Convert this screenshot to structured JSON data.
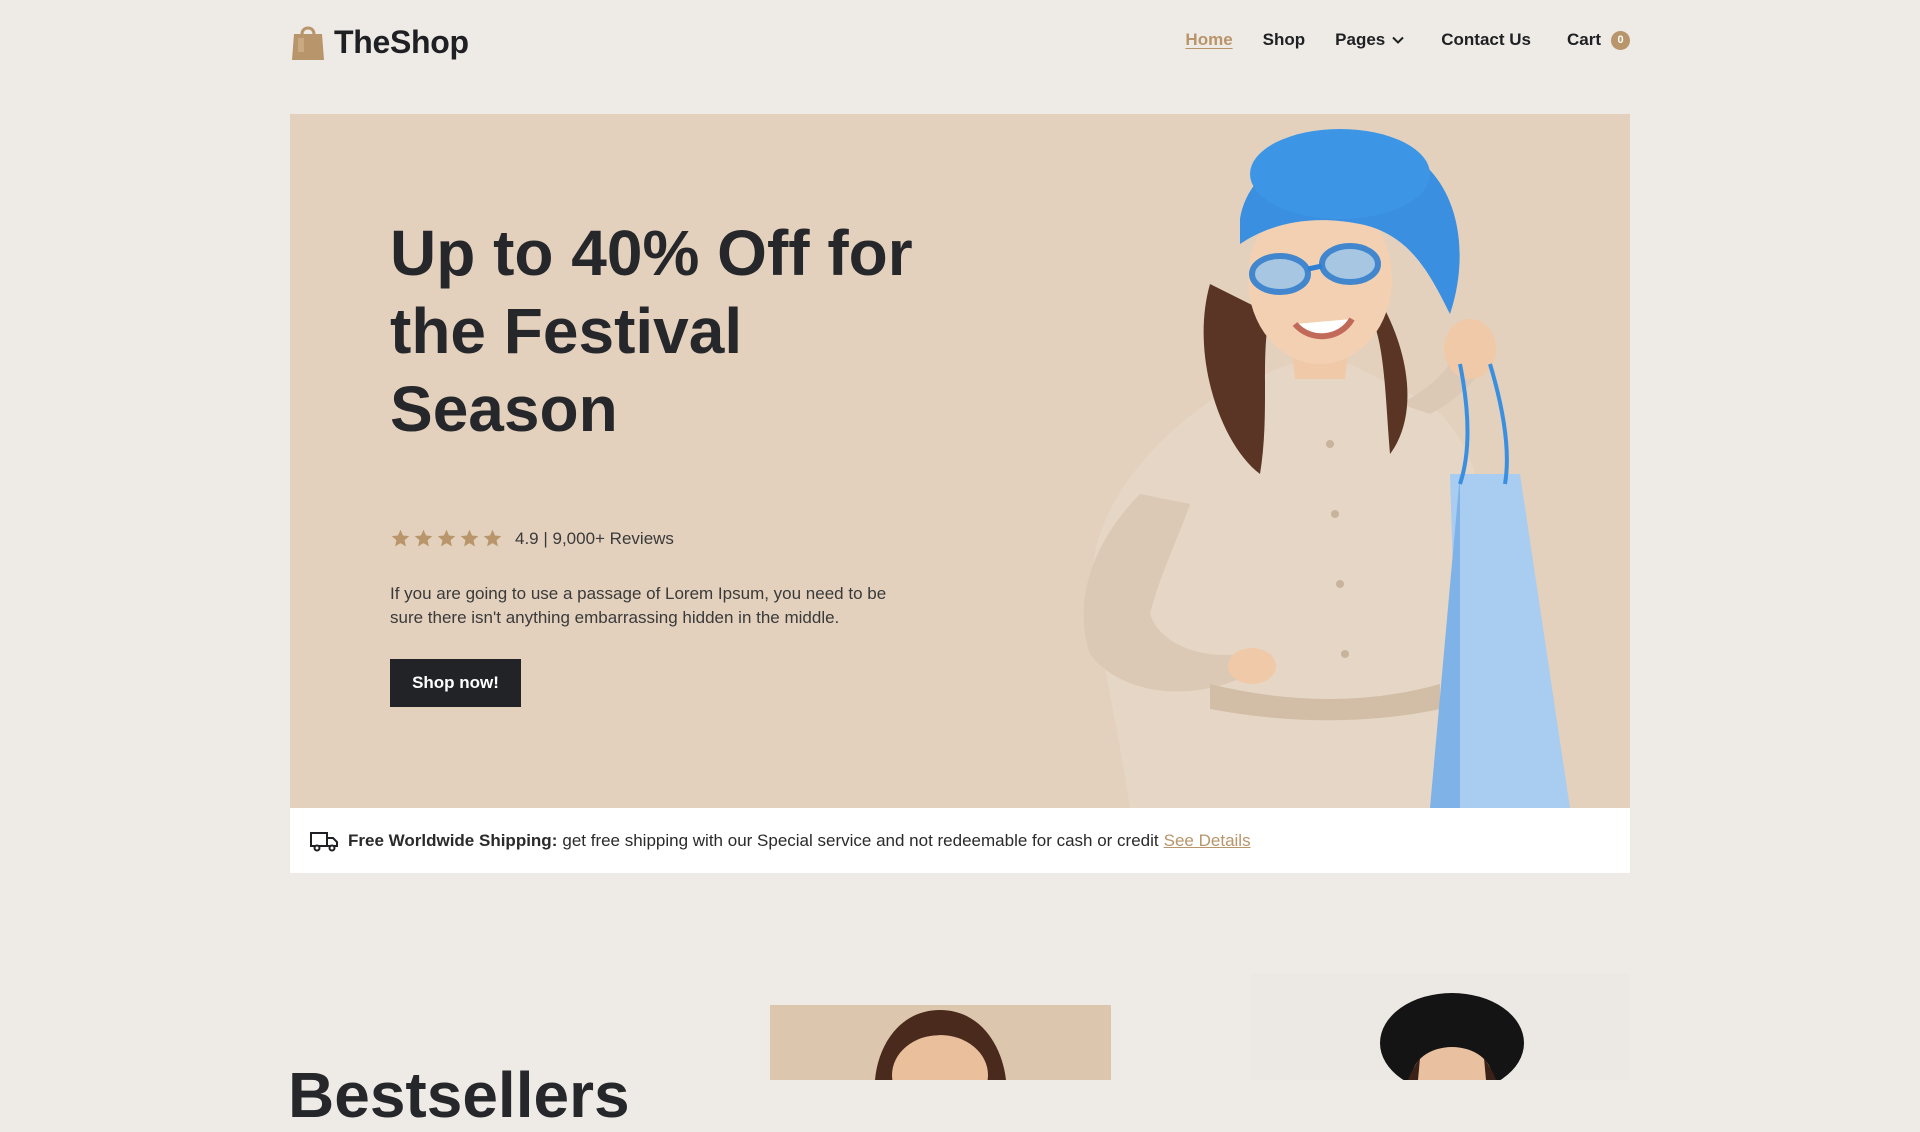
{
  "brand": {
    "name": "TheShop",
    "accent": "#b8956a"
  },
  "nav": {
    "items": [
      {
        "label": "Home",
        "active": true
      },
      {
        "label": "Shop",
        "active": false
      },
      {
        "label": "Pages",
        "active": false,
        "icon": "chevron-down-icon"
      },
      {
        "label": "Contact Us",
        "active": false
      }
    ],
    "cart_label": "Cart",
    "cart_count": "0"
  },
  "hero": {
    "title": "Up to 40% Off for the Festival Season",
    "rating_stars": 5,
    "rating_text": "4.9 | 9,000+ Reviews",
    "description": "If you are going to use a passage of Lorem Ipsum, you need to be sure there isn't anything embarrassing hidden in the middle.",
    "cta_label": "Shop now!",
    "background": "#e3d1bd"
  },
  "shipping": {
    "icon": "truck-icon",
    "strong": "Free Worldwide Shipping:",
    "text": "get free shipping with our Special service and not redeemable for cash or credit",
    "link": "See Details"
  },
  "bestsellers": {
    "title": "Bestsellers"
  }
}
